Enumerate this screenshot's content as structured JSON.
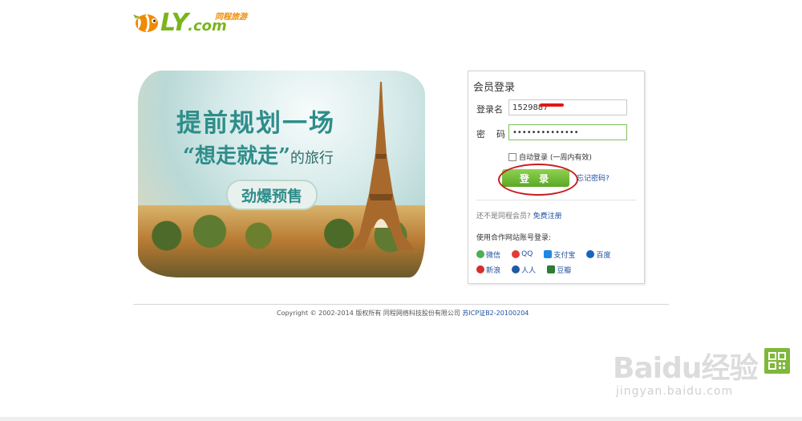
{
  "logo": {
    "text_main": "LY",
    "text_com": ".com",
    "text_cn": "同程旅游"
  },
  "banner": {
    "line1": "提前规划一场",
    "line2_quote": "“想走就走”",
    "line2_tail": "的旅行",
    "pill": "劲爆预售"
  },
  "login": {
    "title": "会员登录",
    "username_label": "登录名",
    "username_value": "1529887",
    "password_label": "密    码",
    "password_value": "••••••••••••••",
    "auto_login": "自动登录 (一周内有效)",
    "login_button": "登 录",
    "forgot": "忘记密码?",
    "register_prompt": "还不是同程会员?",
    "register_link": "免费注册",
    "partner_title": "使用合作网站账号登录:",
    "partners": [
      {
        "label": "微信",
        "color": "#4caf50"
      },
      {
        "label": "QQ",
        "color": "#e53935"
      },
      {
        "label": "支付宝",
        "color": "#1e88e5"
      },
      {
        "label": "百度",
        "color": "#1565c0"
      },
      {
        "label": "新浪",
        "color": "#d32f2f"
      },
      {
        "label": "人人",
        "color": "#1e5aa8"
      },
      {
        "label": "豆瓣",
        "color": "#2e7d32"
      }
    ]
  },
  "footer": {
    "copyright": "Copyright © 2002-2014 版权所有 同程网络科技股份有限公司",
    "icp": "苏ICP证B2-20100204"
  },
  "watermark": {
    "main": "Baidu经验",
    "sub": "jingyan.baidu.com"
  }
}
